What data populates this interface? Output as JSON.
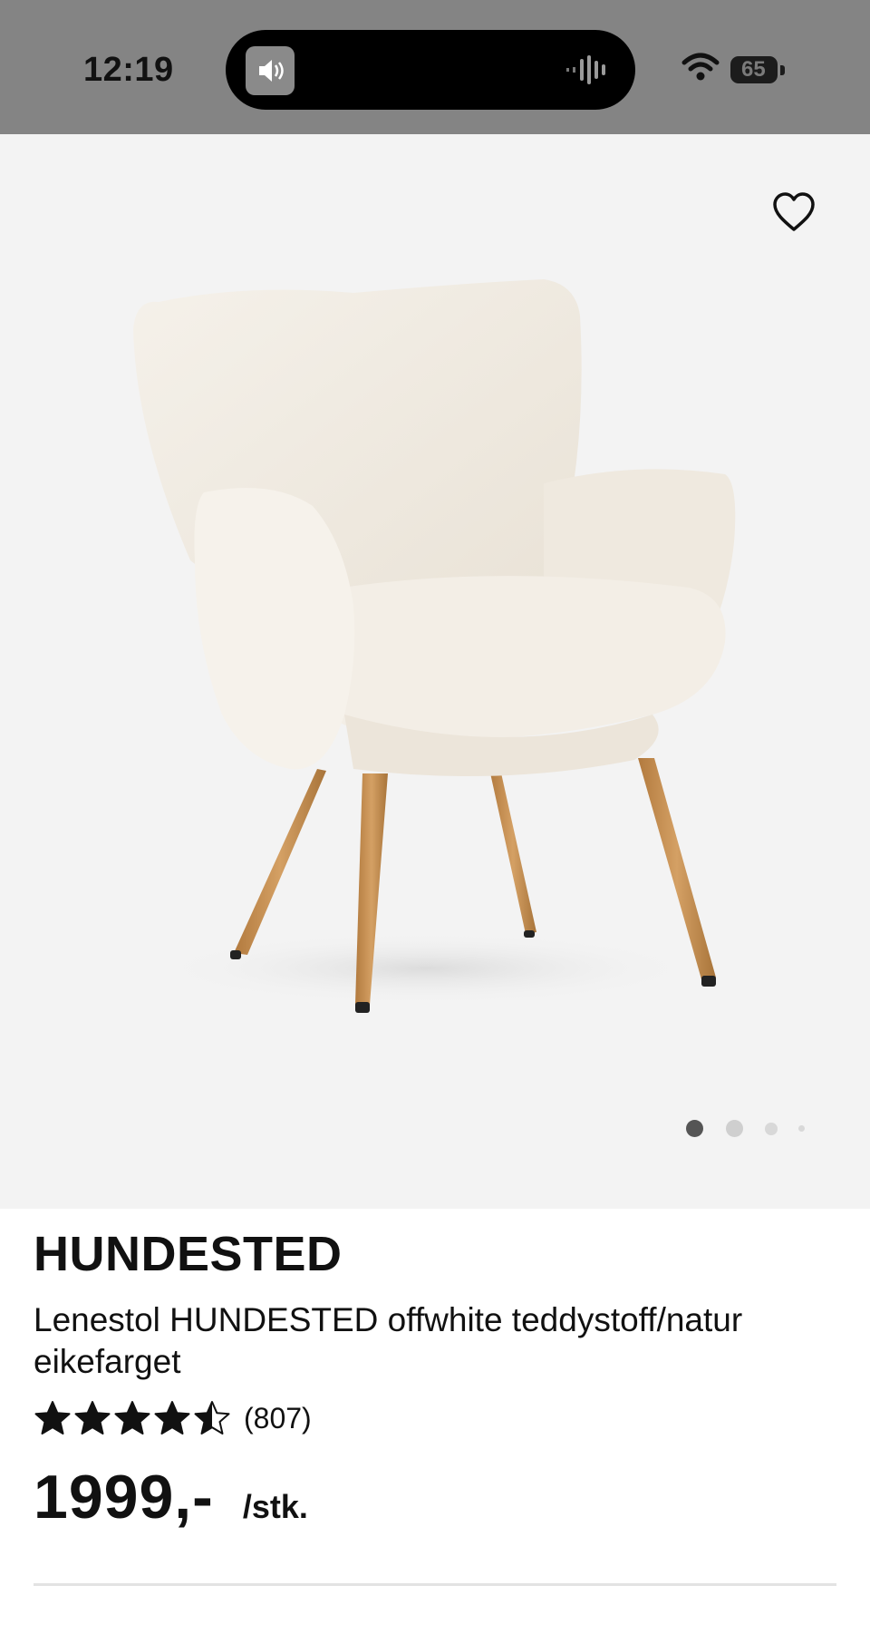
{
  "status_bar": {
    "time": "12:19",
    "battery_level": "65",
    "icons": [
      "speaker-icon",
      "audio-wave-icon",
      "wifi-icon",
      "battery-icon"
    ]
  },
  "gallery": {
    "favorite_icon": "heart-outline-icon",
    "page_count": 4,
    "active_page": 1
  },
  "product": {
    "name": "HUNDESTED",
    "description": "Lenestol HUNDESTED offwhite teddystoff/natur eikefarget",
    "rating": 4.5,
    "review_count": "(807)",
    "price": "1999,-",
    "unit": "/stk."
  },
  "colors": {
    "status_bar_bg": "#848484",
    "image_bg": "#f3f3f3",
    "text": "#111111",
    "fabric": "#f1ece3",
    "wood": "#c58e4f"
  }
}
